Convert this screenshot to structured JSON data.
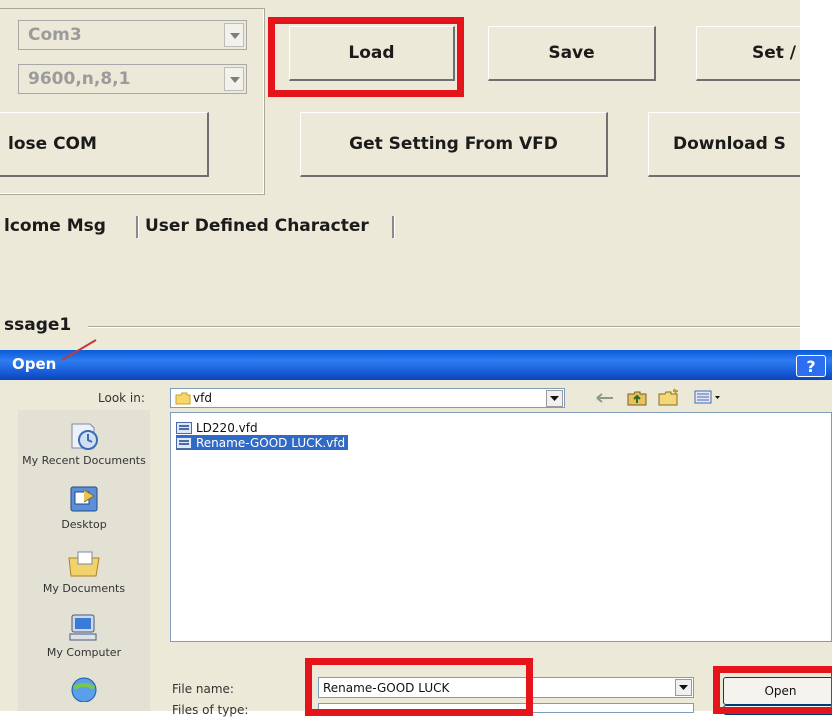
{
  "app": {
    "port_select": {
      "value": "Com3"
    },
    "baud_select": {
      "value": "9600,n,8,1"
    },
    "buttons": {
      "load": "Load",
      "save": "Save",
      "set": "Set /",
      "close_com": "lose COM",
      "get_setting": "Get Setting From VFD",
      "download": "Download S"
    },
    "tabs": [
      {
        "label": "lcome Msg"
      },
      {
        "label": "User Defined Character"
      }
    ],
    "section_label": "ssage1"
  },
  "dialog": {
    "title": "Open",
    "help_label": "?",
    "look_in": {
      "label": "Look in:",
      "value": "vfd"
    },
    "places": [
      {
        "label": "My Recent Documents"
      },
      {
        "label": "Desktop"
      },
      {
        "label": "My Documents"
      },
      {
        "label": "My Computer"
      }
    ],
    "files": [
      {
        "name": "LD220.vfd",
        "selected": false
      },
      {
        "name": "Rename-GOOD LUCK.vfd",
        "selected": true
      }
    ],
    "file_name": {
      "label": "File name:",
      "value": "Rename-GOOD LUCK"
    },
    "file_type": {
      "label": "Files of type:"
    },
    "open_button": "Open"
  },
  "colors": {
    "highlight": "#e5141b",
    "selection": "#316ac5",
    "titlebar": "#0a5ad8",
    "window_bg": "#ece9d8"
  }
}
